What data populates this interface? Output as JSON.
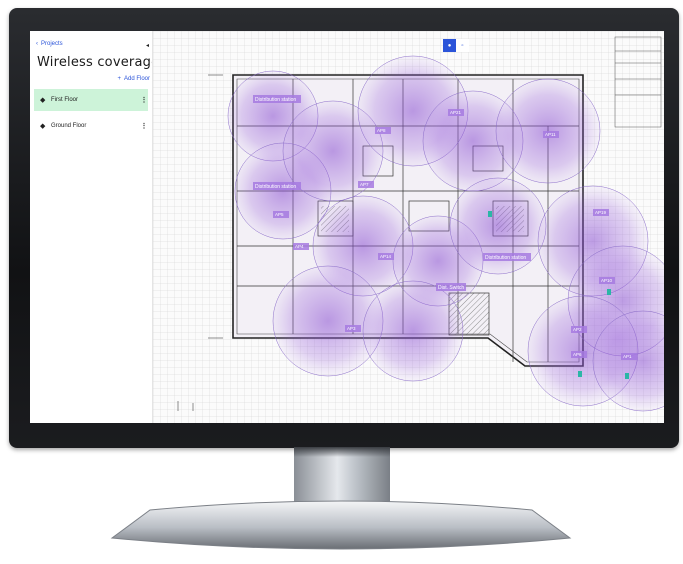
{
  "sidebar": {
    "back_label": "Projects",
    "collapse_icon": "chevron-left",
    "title": "Wireless coverage f",
    "add_floor_label": "Add Floor",
    "floors": [
      {
        "label": "First Floor",
        "active": true
      },
      {
        "label": "Ground Floor",
        "active": false
      }
    ]
  },
  "plan": {
    "view_toggle": [
      "heatmap",
      "grid"
    ],
    "labels": {
      "l1": "Distribution station",
      "l2": "Distribution station",
      "l3": "Distribution station",
      "l4": "Dist. Switch",
      "ap1": "AP21",
      "ap2": "AP8",
      "ap3": "AP11",
      "ap4": "AP19",
      "ap5": "AP7",
      "ap6": "AP5",
      "ap7": "AP4",
      "ap8": "AP14",
      "ap9": "AP3",
      "ap10": "AP2",
      "ap11": "AP10",
      "ap12": "AP6",
      "ap13": "AP1"
    }
  },
  "colors": {
    "accent": "#2b54d9",
    "active_floor_bg": "#cdf3d9",
    "coverage": "#8a4fd1"
  }
}
